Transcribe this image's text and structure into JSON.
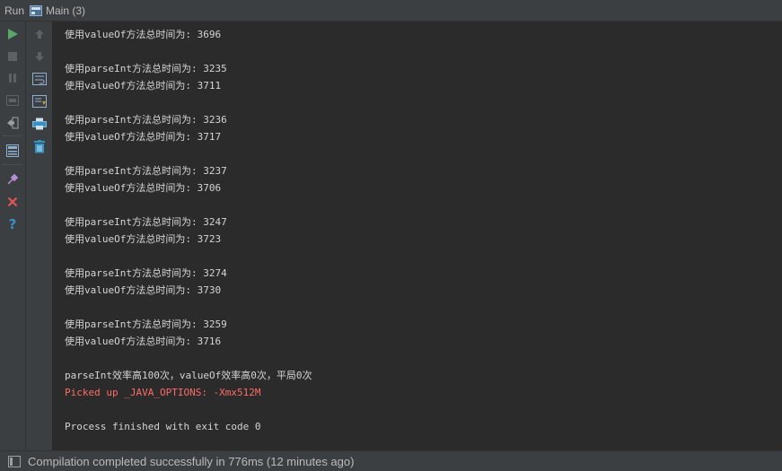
{
  "titlebar": {
    "run_label": "Run",
    "tab_label": "Main (3)",
    "tab_icon": "run-config-icon"
  },
  "toolbar_left": {
    "buttons": [
      {
        "name": "rerun-icon",
        "color": "#59a869"
      },
      {
        "name": "stop-icon"
      },
      {
        "name": "pause-icon"
      },
      {
        "name": "dump-threads-icon"
      },
      {
        "name": "exit-icon"
      },
      {
        "name": "restore-layout-icon"
      },
      {
        "name": "pin-tab-icon"
      },
      {
        "name": "close-icon",
        "color": "#e05555"
      },
      {
        "name": "help-icon",
        "color": "#3592c4"
      }
    ]
  },
  "toolbar_right": {
    "buttons": [
      {
        "name": "up-arrow-icon"
      },
      {
        "name": "down-arrow-icon"
      },
      {
        "name": "soft-wrap-icon"
      },
      {
        "name": "scroll-to-end-icon"
      },
      {
        "name": "print-icon"
      },
      {
        "name": "clear-all-icon"
      }
    ]
  },
  "console": {
    "lines": [
      "使用valueOf方法总时间为: 3696",
      "",
      "使用parseInt方法总时间为: 3235",
      "使用valueOf方法总时间为: 3711",
      "",
      "使用parseInt方法总时间为: 3236",
      "使用valueOf方法总时间为: 3717",
      "",
      "使用parseInt方法总时间为: 3237",
      "使用valueOf方法总时间为: 3706",
      "",
      "使用parseInt方法总时间为: 3247",
      "使用valueOf方法总时间为: 3723",
      "",
      "使用parseInt方法总时间为: 3274",
      "使用valueOf方法总时间为: 3730",
      "",
      "使用parseInt方法总时间为: 3259",
      "使用valueOf方法总时间为: 3716",
      "",
      "parseInt效率高100次，valueOf效率高0次，平局0次",
      "Picked up _JAVA_OPTIONS: -Xmx512M",
      "",
      "Process finished with exit code 0"
    ],
    "error_line_index": 21,
    "text_color": "#d4d4d4",
    "error_color": "#ff6b68"
  },
  "statusbar": {
    "message": "Compilation completed successfully in 776ms (12 minutes ago)",
    "icon": "tool-window-toggle-icon"
  }
}
